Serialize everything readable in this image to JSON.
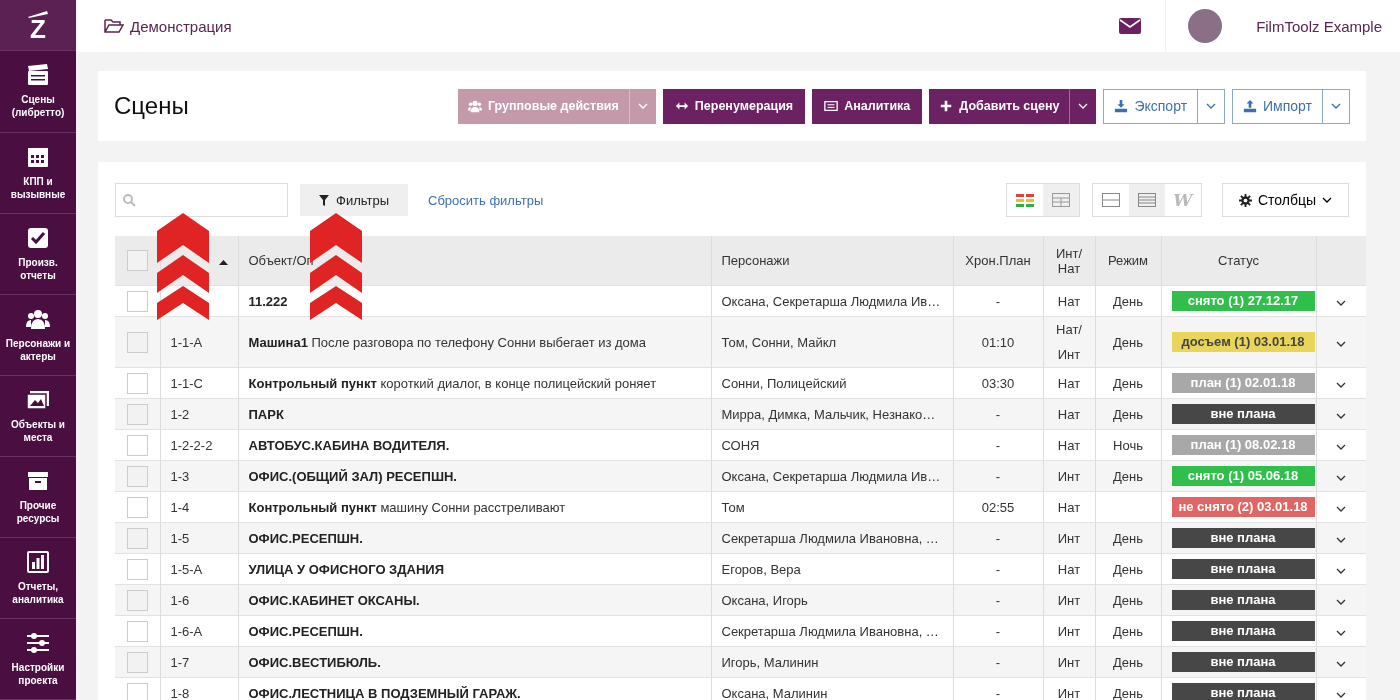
{
  "logo": "Z",
  "sidebar": {
    "items": [
      {
        "label": "Сцены (либретто)"
      },
      {
        "label": "КПП и вызывные"
      },
      {
        "label": "Произв. отчеты"
      },
      {
        "label": "Персонажи и актеры"
      },
      {
        "label": "Объекты и места"
      },
      {
        "label": "Прочие ресурсы"
      },
      {
        "label": "Отчеты, аналитика"
      },
      {
        "label": "Настройки проекта"
      }
    ]
  },
  "topbar": {
    "breadcrumb": "Демонстрация",
    "user": "FilmToolz Example"
  },
  "page_title": "Сцены",
  "actions": [
    {
      "label": "Групповые действия",
      "kind": "solid",
      "split": true,
      "disabled": true
    },
    {
      "label": "Перенумерация",
      "kind": "solid",
      "split": false,
      "disabled": false
    },
    {
      "label": "Аналитика",
      "kind": "solid",
      "split": false,
      "disabled": false
    },
    {
      "label": "Добавить сцену",
      "kind": "solid",
      "split": true,
      "disabled": false
    },
    {
      "label": "Экспорт",
      "kind": "outline",
      "split": true,
      "disabled": false
    },
    {
      "label": "Импорт",
      "kind": "outline",
      "split": true,
      "disabled": false
    }
  ],
  "filters": {
    "button": "Фильтры",
    "reset": "Сбросить фильтры"
  },
  "view_modes": [
    {
      "selected": false
    },
    {
      "selected": true
    }
  ],
  "row_modes": [
    {
      "selected": false
    },
    {
      "selected": true
    },
    {
      "selected": false,
      "label": "W"
    }
  ],
  "columns_button": "Столбцы",
  "table": {
    "select_all": {
      "checked": false
    },
    "columns": [
      {
        "sorted": true
      },
      {
        "label": "Объект/Оп"
      },
      {
        "label": "Персонажи"
      },
      {
        "label": "Хрон.План"
      },
      {
        "label": "Инт/Нат"
      },
      {
        "label": "Режим"
      },
      {
        "label": "Статус"
      }
    ],
    "rows": [
      {
        "checked": false,
        "object": "**11.222**",
        "characters": "Оксана, Секретарша Людмила Ив…",
        "duration": "-",
        "int_nat": "Нат",
        "mode": "День",
        "status": {
          "text": "снято (1) 27.12.17",
          "color": "#2fbf4a"
        }
      },
      {
        "checked": false,
        "number": "1-1-A",
        "object": "**Машина1** После разговора по телефону Сонни выбегает из дома",
        "characters": "Том, Сонни, Майкл",
        "duration": "01:10",
        "int_nat": "Нат/Инт",
        "mode": "День",
        "status": {
          "text": "досъем (1) 03.01.18",
          "color": "#e8d55a"
        }
      },
      {
        "checked": false,
        "number": "1-1-C",
        "object": "**Контрольный пункт** короткий диалог, в конце полицейский роняет",
        "characters": "Сонни, Полицейский",
        "duration": "03:30",
        "int_nat": "Нат",
        "mode": "День",
        "status": {
          "text": "план (1) 02.01.18",
          "color": "#a8a8a8"
        }
      },
      {
        "checked": false,
        "number": "1-2",
        "object": "**ПАРК**",
        "characters": "Мирра, Димка, Мальчик, Незнако…",
        "duration": "-",
        "int_nat": "Нат",
        "mode": "День",
        "status": {
          "text": "вне плана",
          "color": "#474747"
        }
      },
      {
        "checked": false,
        "number": "1-2-2-2",
        "object": "**АВТОБУС.КАБИНА ВОДИТЕЛЯ.**",
        "characters": "СОНЯ",
        "duration": "-",
        "int_nat": "Нат",
        "mode": "Ночь",
        "status": {
          "text": "план (1) 08.02.18",
          "color": "#a8a8a8"
        }
      },
      {
        "checked": false,
        "number": "1-3",
        "object": "**ОФИС.(ОБЩИЙ ЗАЛ) РЕСЕПШН.**",
        "characters": "Оксана, Секретарша Людмила Ив…",
        "duration": "-",
        "int_nat": "Инт",
        "mode": "День",
        "status": {
          "text": "снято (1) 05.06.18",
          "color": "#2fbf4a"
        }
      },
      {
        "checked": false,
        "number": "1-4",
        "object": "**Контрольный пункт** машину Сонни расстреливают",
        "characters": "Том",
        "duration": "02:55",
        "int_nat": "Нат",
        "status": {
          "text": "не снято (2) 03.01.18",
          "color": "#e06565"
        }
      },
      {
        "checked": false,
        "number": "1-5",
        "object": "**ОФИС.РЕСЕПШН.**",
        "characters": "Секретарша Людмила Ивановна, …",
        "duration": "-",
        "int_nat": "Инт",
        "mode": "День",
        "status": {
          "text": "вне плана",
          "color": "#474747"
        }
      },
      {
        "checked": false,
        "number": "1-5-A",
        "object": "**УЛИЦА У ОФИСНОГО ЗДАНИЯ**",
        "characters": "Егоров, Вера",
        "duration": "-",
        "int_nat": "Нат",
        "mode": "День",
        "status": {
          "text": "вне плана",
          "color": "#474747"
        }
      },
      {
        "checked": false,
        "number": "1-6",
        "object": "**ОФИС.КАБИНЕТ ОКСАНЫ.**",
        "characters": "Оксана, Игорь",
        "duration": "-",
        "int_nat": "Инт",
        "mode": "День",
        "status": {
          "text": "вне плана",
          "color": "#474747"
        }
      },
      {
        "checked": false,
        "number": "1-6-A",
        "object": "**ОФИС.РЕСЕПШН.**",
        "characters": "Секретарша Людмила Ивановна, …",
        "duration": "-",
        "int_nat": "Инт",
        "mode": "День",
        "status": {
          "text": "вне плана",
          "color": "#474747"
        }
      },
      {
        "checked": false,
        "number": "1-7",
        "object": "**ОФИС.ВЕСТИБЮЛЬ.**",
        "characters": "Игорь, Малинин",
        "duration": "-",
        "int_nat": "Инт",
        "mode": "День",
        "status": {
          "text": "вне плана",
          "color": "#474747"
        }
      },
      {
        "checked": false,
        "number": "1-8",
        "object": "**ОФИС.ЛЕСТНИЦА В ПОДЗЕМНЫЙ ГАРАЖ.**",
        "characters": "Оксана, Малинин",
        "duration": "-",
        "int_nat": "Инт",
        "mode": "День",
        "status": {
          "text": "вне плана",
          "color": "#474747"
        }
      }
    ]
  }
}
